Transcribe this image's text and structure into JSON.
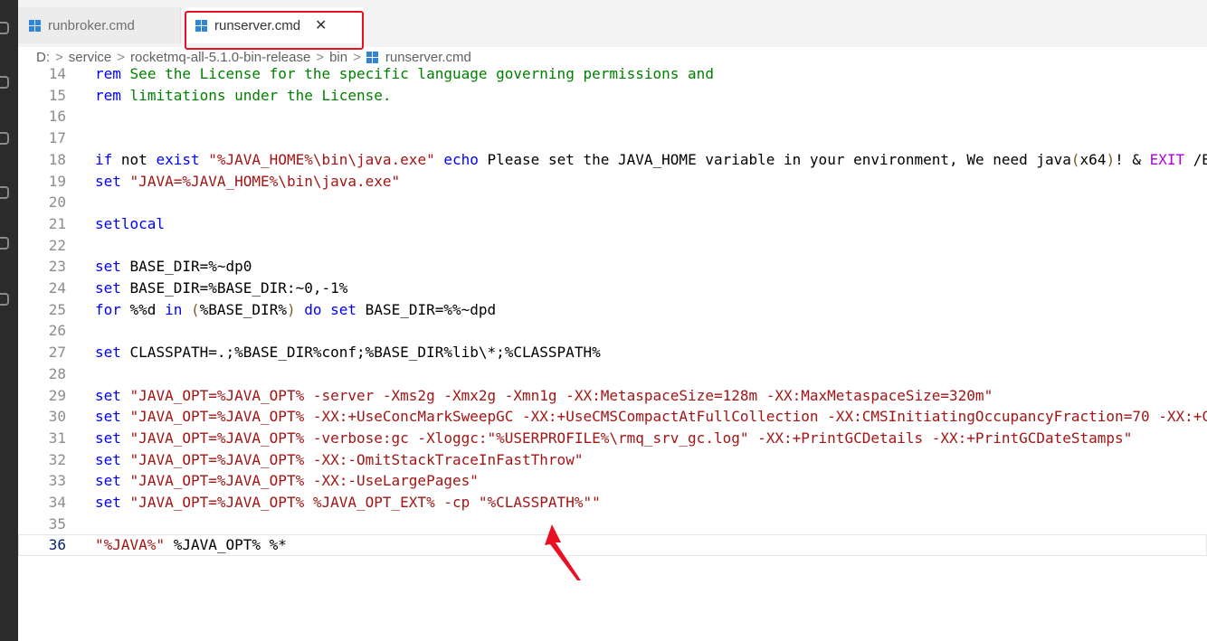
{
  "tabs": [
    {
      "label": "runbroker.cmd",
      "active": false
    },
    {
      "label": "runserver.cmd",
      "active": true
    }
  ],
  "close_glyph": "✕",
  "breadcrumb": [
    "D:",
    "service",
    "rocketmq-all-5.1.0-bin-release",
    "bin",
    "runserver.cmd"
  ],
  "breadcrumb_separator": ">",
  "lines": [
    {
      "n": "14",
      "segs": [
        [
          "kw",
          "rem"
        ],
        [
          "pl",
          " "
        ],
        [
          "cm",
          "See the License for the specific language governing permissions and"
        ]
      ]
    },
    {
      "n": "15",
      "segs": [
        [
          "kw",
          "rem"
        ],
        [
          "pl",
          " "
        ],
        [
          "cm",
          "limitations under the License."
        ]
      ]
    },
    {
      "n": "16",
      "segs": []
    },
    {
      "n": "17",
      "segs": []
    },
    {
      "n": "18",
      "segs": [
        [
          "kw",
          "if"
        ],
        [
          "pl",
          " not "
        ],
        [
          "kw",
          "exist"
        ],
        [
          "pl",
          " "
        ],
        [
          "str",
          "\"%JAVA_HOME%\\bin\\java.exe\""
        ],
        [
          "pl",
          " "
        ],
        [
          "kw",
          "echo"
        ],
        [
          "pl",
          " Please set the JAVA_HOME variable in your environment, We need java"
        ],
        [
          "paren",
          "("
        ],
        [
          "pl",
          "x64"
        ],
        [
          "paren",
          ")"
        ],
        [
          "pl",
          "! & "
        ],
        [
          "kw2",
          "EXIT"
        ],
        [
          "pl",
          " /B"
        ]
      ]
    },
    {
      "n": "19",
      "segs": [
        [
          "kw",
          "set"
        ],
        [
          "pl",
          " "
        ],
        [
          "str",
          "\"JAVA=%JAVA_HOME%\\bin\\java.exe\""
        ]
      ]
    },
    {
      "n": "20",
      "segs": []
    },
    {
      "n": "21",
      "segs": [
        [
          "kw",
          "setlocal"
        ]
      ]
    },
    {
      "n": "22",
      "segs": []
    },
    {
      "n": "23",
      "segs": [
        [
          "kw",
          "set"
        ],
        [
          "pl",
          " BASE_DIR=%~dp0"
        ]
      ]
    },
    {
      "n": "24",
      "segs": [
        [
          "kw",
          "set"
        ],
        [
          "pl",
          " BASE_DIR=%BASE_DIR:~0,-1%"
        ]
      ]
    },
    {
      "n": "25",
      "segs": [
        [
          "kw",
          "for"
        ],
        [
          "pl",
          " %%d "
        ],
        [
          "kw",
          "in"
        ],
        [
          "pl",
          " "
        ],
        [
          "paren",
          "("
        ],
        [
          "pl",
          "%BASE_DIR%"
        ],
        [
          "paren",
          ")"
        ],
        [
          "pl",
          " "
        ],
        [
          "kw",
          "do"
        ],
        [
          "pl",
          " "
        ],
        [
          "kw",
          "set"
        ],
        [
          "pl",
          " BASE_DIR=%%~dpd"
        ]
      ]
    },
    {
      "n": "26",
      "segs": []
    },
    {
      "n": "27",
      "segs": [
        [
          "kw",
          "set"
        ],
        [
          "pl",
          " CLASSPATH=.;%BASE_DIR%conf;%BASE_DIR%lib\\*;%CLASSPATH%"
        ]
      ]
    },
    {
      "n": "28",
      "segs": []
    },
    {
      "n": "29",
      "segs": [
        [
          "kw",
          "set"
        ],
        [
          "pl",
          " "
        ],
        [
          "str",
          "\"JAVA_OPT=%JAVA_OPT% -server -Xms2g -Xmx2g -Xmn1g -XX:MetaspaceSize=128m -XX:MaxMetaspaceSize=320m\""
        ]
      ]
    },
    {
      "n": "30",
      "segs": [
        [
          "kw",
          "set"
        ],
        [
          "pl",
          " "
        ],
        [
          "str",
          "\"JAVA_OPT=%JAVA_OPT% -XX:+UseConcMarkSweepGC -XX:+UseCMSCompactAtFullCollection -XX:CMSInitiatingOccupancyFraction=70 -XX:+C"
        ]
      ]
    },
    {
      "n": "31",
      "segs": [
        [
          "kw",
          "set"
        ],
        [
          "pl",
          " "
        ],
        [
          "str",
          "\"JAVA_OPT=%JAVA_OPT% -verbose:gc -Xloggc:\"%USERPROFILE%\\rmq_srv_gc.log\" -XX:+PrintGCDetails -XX:+PrintGCDateStamps\""
        ]
      ]
    },
    {
      "n": "32",
      "segs": [
        [
          "kw",
          "set"
        ],
        [
          "pl",
          " "
        ],
        [
          "str",
          "\"JAVA_OPT=%JAVA_OPT% -XX:-OmitStackTraceInFastThrow\""
        ]
      ]
    },
    {
      "n": "33",
      "segs": [
        [
          "kw",
          "set"
        ],
        [
          "pl",
          " "
        ],
        [
          "str",
          "\"JAVA_OPT=%JAVA_OPT% -XX:-UseLargePages\""
        ]
      ]
    },
    {
      "n": "34",
      "segs": [
        [
          "kw",
          "set"
        ],
        [
          "pl",
          " "
        ],
        [
          "str",
          "\"JAVA_OPT=%JAVA_OPT% %JAVA_OPT_EXT% -cp \"%CLASSPATH%\"\""
        ]
      ]
    },
    {
      "n": "35",
      "segs": []
    },
    {
      "n": "36",
      "segs": [
        [
          "str",
          "\"%JAVA%\""
        ],
        [
          "pl",
          " %JAVA_OPT% %*"
        ]
      ],
      "current": true
    }
  ],
  "colors": {
    "keyword": "#0000ff",
    "comment": "#008000",
    "string": "#a31515",
    "annotation_red": "#e81123"
  }
}
